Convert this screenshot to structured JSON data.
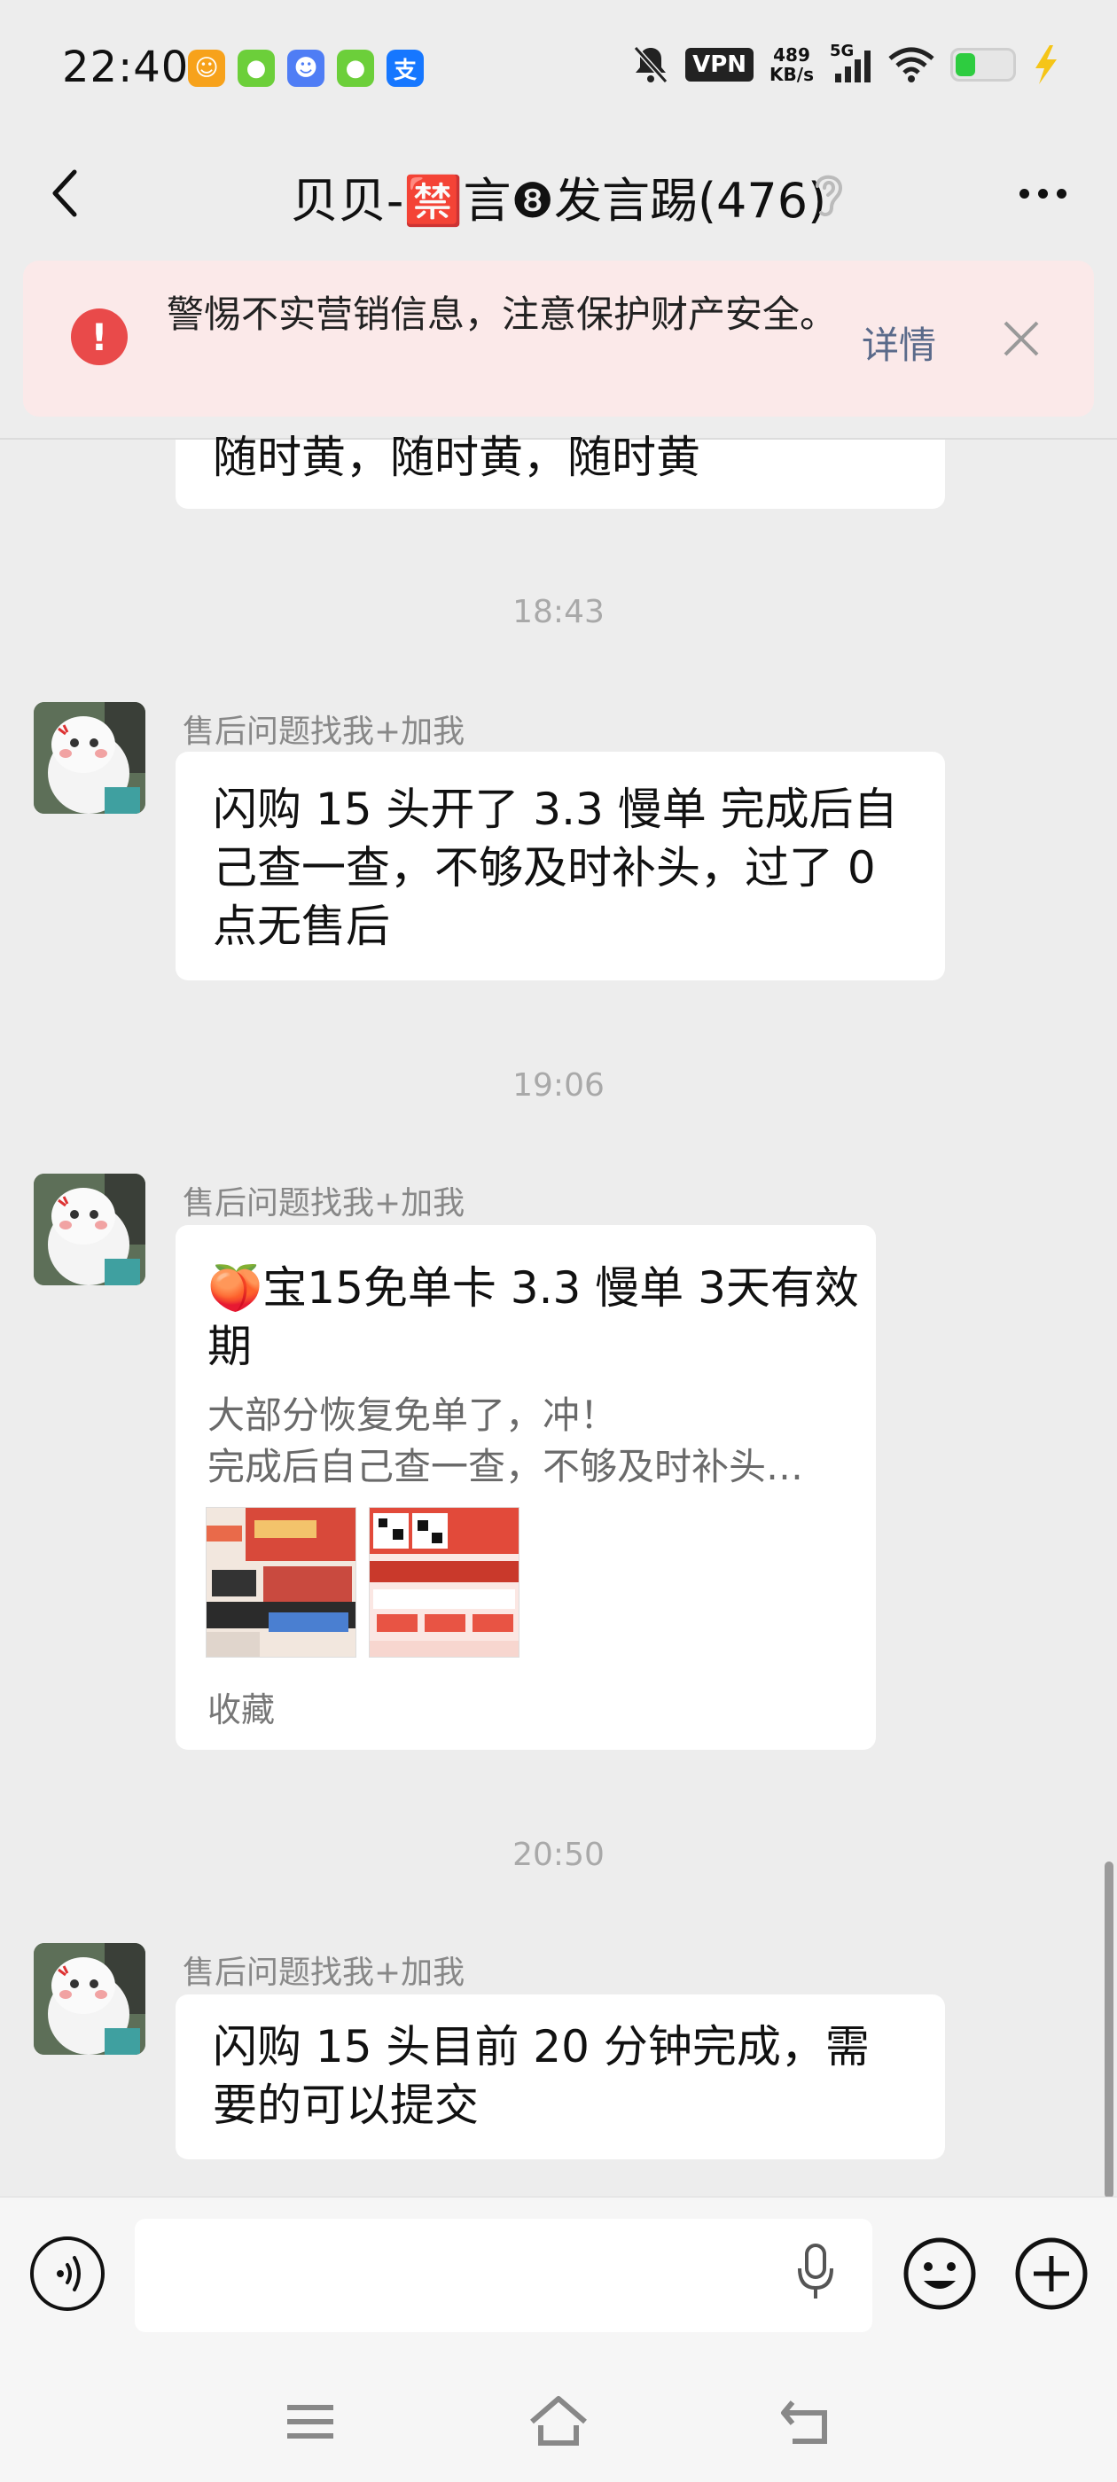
{
  "status_bar": {
    "time": "22:40",
    "vpn": "VPN",
    "net_speed_value": "489",
    "net_speed_unit": "KB/s",
    "network": "5G",
    "battery_level": 0.35,
    "app_icons": [
      {
        "name": "accessibility-app-icon",
        "glyph": "☺",
        "color": "#f7a21b"
      },
      {
        "name": "green-app-icon",
        "glyph": "●",
        "color": "#6ccf3a"
      },
      {
        "name": "qq-app-icon",
        "glyph": "☻",
        "color": "#4f7df5"
      },
      {
        "name": "green-app-icon-2",
        "glyph": "●",
        "color": "#6ccf3a"
      },
      {
        "name": "alipay-app-icon",
        "glyph": "支",
        "color": "#1677ff"
      }
    ]
  },
  "header": {
    "title": "贝贝-🈲言❽发言踢(476)"
  },
  "warning": {
    "icon": "!",
    "text": "警惕不实营销信息，注意保护财产安全。",
    "detail_label": "详情"
  },
  "messages": {
    "partial_text": "随时黄，随时黄，随时黄",
    "t1": "18:43",
    "sender1": "售后问题找我+加我",
    "m1_text": "闪购 15 头开了 3.3 慢单 完成后自己查一查，不够及时补头，过了 0 点无售后",
    "t2": "19:06",
    "sender2": "售后问题找我+加我",
    "card": {
      "title": "🍑宝15免单卡 3.3 慢单 3天有效期",
      "desc_line1": "大部分恢复免单了，冲！",
      "desc_line2": "完成后自己查一查，不够及时补头…",
      "footer": "收藏"
    },
    "t3": "20:50",
    "sender3": "售后问题找我+加我",
    "m3_text": "闪购 15 头目前 20 分钟完成，需要的可以提交"
  }
}
